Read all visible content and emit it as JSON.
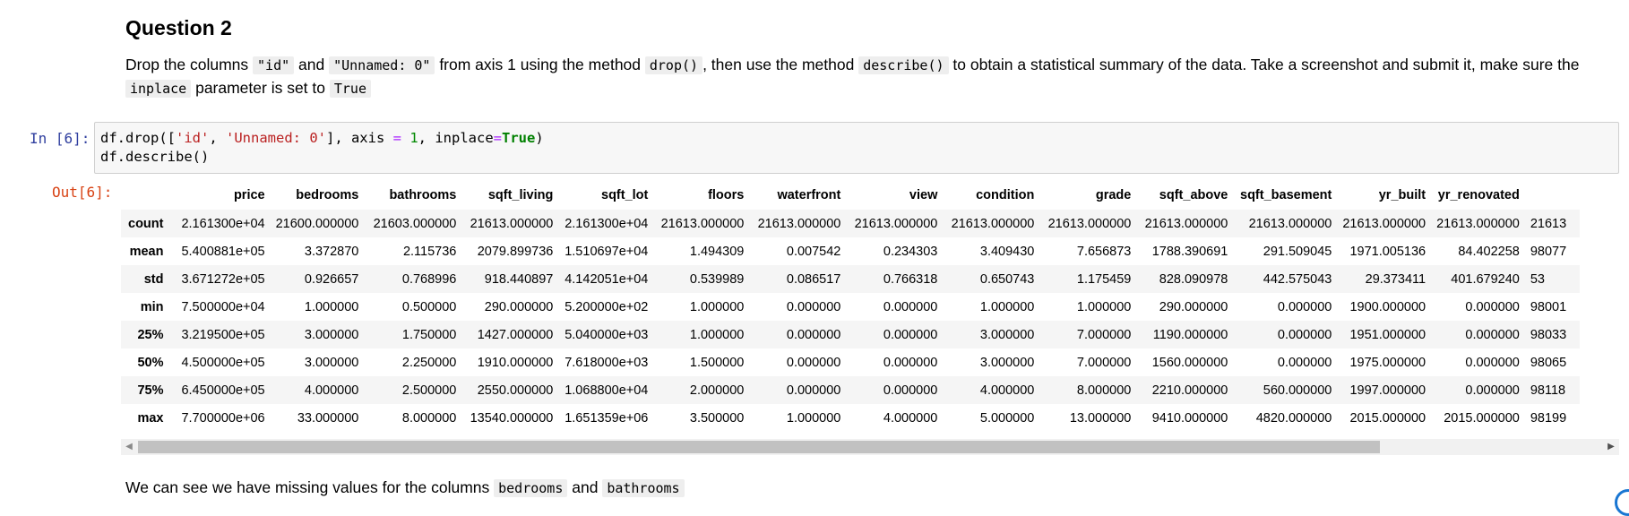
{
  "heading": "Question 2",
  "instructions": {
    "t1": "Drop the columns ",
    "c1": "\"id\"",
    "t2": " and ",
    "c2": "\"Unnamed: 0\"",
    "t3": " from axis 1 using the method ",
    "c3": "drop()",
    "t4": ", then use the method ",
    "c4": "describe()",
    "t5": " to obtain a statistical summary of the data. Take a screenshot and submit it, make sure the ",
    "c5": "inplace",
    "t6": " parameter is set to ",
    "c6": "True"
  },
  "cell": {
    "in_prompt": "In [6]:",
    "out_prompt": "Out[6]:",
    "code": {
      "a1": "df.drop([",
      "s1": "'id'",
      "a2": ", ",
      "s2": "'Unnamed: 0'",
      "a3": "], axis ",
      "op1": "=",
      "a4": " ",
      "n1": "1",
      "a5": ", inplace",
      "op2": "=",
      "kw1": "True",
      "a6": ")",
      "line2": "df.describe()"
    }
  },
  "table": {
    "columns": [
      "price",
      "bedrooms",
      "bathrooms",
      "sqft_living",
      "sqft_lot",
      "floors",
      "waterfront",
      "view",
      "condition",
      "grade",
      "sqft_above",
      "sqft_basement",
      "yr_built",
      "yr_renovated",
      ""
    ],
    "rows": [
      {
        "label": "count",
        "values": [
          "2.161300e+04",
          "21600.000000",
          "21603.000000",
          "21613.000000",
          "2.161300e+04",
          "21613.000000",
          "21613.000000",
          "21613.000000",
          "21613.000000",
          "21613.000000",
          "21613.000000",
          "21613.000000",
          "21613.000000",
          "21613.000000",
          "21613"
        ]
      },
      {
        "label": "mean",
        "values": [
          "5.400881e+05",
          "3.372870",
          "2.115736",
          "2079.899736",
          "1.510697e+04",
          "1.494309",
          "0.007542",
          "0.234303",
          "3.409430",
          "7.656873",
          "1788.390691",
          "291.509045",
          "1971.005136",
          "84.402258",
          "98077"
        ]
      },
      {
        "label": "std",
        "values": [
          "3.671272e+05",
          "0.926657",
          "0.768996",
          "918.440897",
          "4.142051e+04",
          "0.539989",
          "0.086517",
          "0.766318",
          "0.650743",
          "1.175459",
          "828.090978",
          "442.575043",
          "29.373411",
          "401.679240",
          "53"
        ]
      },
      {
        "label": "min",
        "values": [
          "7.500000e+04",
          "1.000000",
          "0.500000",
          "290.000000",
          "5.200000e+02",
          "1.000000",
          "0.000000",
          "0.000000",
          "1.000000",
          "1.000000",
          "290.000000",
          "0.000000",
          "1900.000000",
          "0.000000",
          "98001"
        ]
      },
      {
        "label": "25%",
        "values": [
          "3.219500e+05",
          "3.000000",
          "1.750000",
          "1427.000000",
          "5.040000e+03",
          "1.000000",
          "0.000000",
          "0.000000",
          "3.000000",
          "7.000000",
          "1190.000000",
          "0.000000",
          "1951.000000",
          "0.000000",
          "98033"
        ]
      },
      {
        "label": "50%",
        "values": [
          "4.500000e+05",
          "3.000000",
          "2.250000",
          "1910.000000",
          "7.618000e+03",
          "1.500000",
          "0.000000",
          "0.000000",
          "3.000000",
          "7.000000",
          "1560.000000",
          "0.000000",
          "1975.000000",
          "0.000000",
          "98065"
        ]
      },
      {
        "label": "75%",
        "values": [
          "6.450000e+05",
          "4.000000",
          "2.500000",
          "2550.000000",
          "1.068800e+04",
          "2.000000",
          "0.000000",
          "0.000000",
          "4.000000",
          "8.000000",
          "2210.000000",
          "560.000000",
          "1997.000000",
          "0.000000",
          "98118"
        ]
      },
      {
        "label": "max",
        "values": [
          "7.700000e+06",
          "33.000000",
          "8.000000",
          "13540.000000",
          "1.651359e+06",
          "3.500000",
          "1.000000",
          "4.000000",
          "5.000000",
          "13.000000",
          "9410.000000",
          "4820.000000",
          "2015.000000",
          "2015.000000",
          "98199"
        ]
      }
    ]
  },
  "scrollbar": {
    "left_arrow": "◀",
    "right_arrow": "▶"
  },
  "note": {
    "t1": "We can see we have missing values for the columns ",
    "c1": "bedrooms",
    "t2": " and ",
    "c2": "bathrooms"
  }
}
